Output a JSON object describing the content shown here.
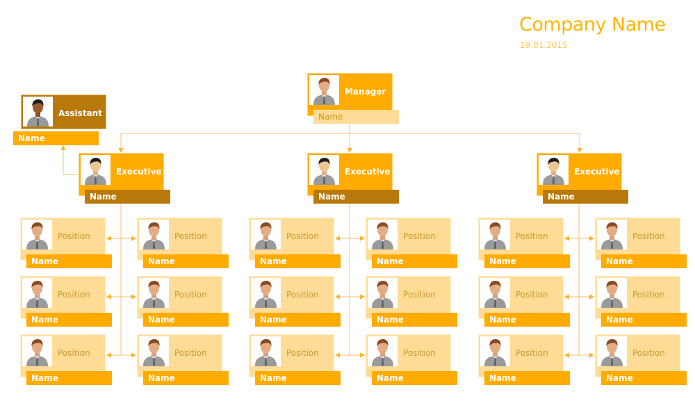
{
  "header": {
    "company": "Company Name",
    "date": "19.01.2015"
  },
  "colors": {
    "accent": "#ffab00",
    "dark": "#b8790a",
    "light": "#ffdc96",
    "line": "#ffc98a"
  },
  "manager": {
    "role": "Manager",
    "name": "Name",
    "icon": "person-avatar-icon"
  },
  "assistant": {
    "role": "Assistant",
    "name": "Name",
    "icon": "person-avatar-dark-icon"
  },
  "executives": [
    {
      "role": "Executive",
      "name": "Name",
      "positions": [
        {
          "role": "Position",
          "name": "Name"
        },
        {
          "role": "Position",
          "name": "Name"
        },
        {
          "role": "Position",
          "name": "Name"
        },
        {
          "role": "Position",
          "name": "Name"
        },
        {
          "role": "Position",
          "name": "Name"
        },
        {
          "role": "Position",
          "name": "Name"
        }
      ]
    },
    {
      "role": "Executive",
      "name": "Name",
      "positions": [
        {
          "role": "Position",
          "name": "Name"
        },
        {
          "role": "Position",
          "name": "Name"
        },
        {
          "role": "Position",
          "name": "Name"
        },
        {
          "role": "Position",
          "name": "Name"
        },
        {
          "role": "Position",
          "name": "Name"
        },
        {
          "role": "Position",
          "name": "Name"
        }
      ]
    },
    {
      "role": "Executive",
      "name": "Name",
      "positions": [
        {
          "role": "Position",
          "name": "Name"
        },
        {
          "role": "Position",
          "name": "Name"
        },
        {
          "role": "Position",
          "name": "Name"
        },
        {
          "role": "Position",
          "name": "Name"
        },
        {
          "role": "Position",
          "name": "Name"
        },
        {
          "role": "Position",
          "name": "Name"
        }
      ]
    }
  ]
}
